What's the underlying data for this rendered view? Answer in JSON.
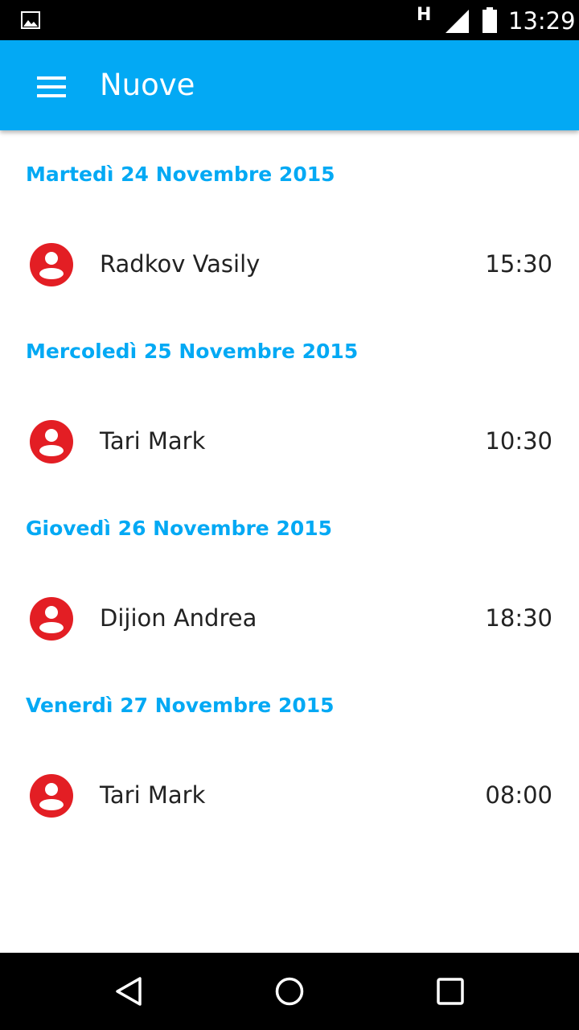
{
  "status_bar": {
    "network_type": "H",
    "time": "13:29",
    "icons": [
      "gallery-icon",
      "signal-icon",
      "battery-icon"
    ]
  },
  "app_bar": {
    "title": "Nuove",
    "menu_icon": "menu-icon"
  },
  "days": [
    {
      "date": "Martedì 24 Novembre 2015",
      "entries": [
        {
          "name": "Radkov Vasily",
          "time": "15:30"
        }
      ]
    },
    {
      "date": "Mercoledì 25 Novembre 2015",
      "entries": [
        {
          "name": "Tari Mark",
          "time": "10:30"
        }
      ]
    },
    {
      "date": "Giovedì 26 Novembre 2015",
      "entries": [
        {
          "name": "Dijion Andrea",
          "time": "18:30"
        }
      ]
    },
    {
      "date": "Venerdì 27 Novembre 2015",
      "entries": [
        {
          "name": "Tari Mark",
          "time": "08:00"
        }
      ]
    }
  ],
  "colors": {
    "primary": "#03A9F4",
    "accent": "#E31E24",
    "text": "#222222",
    "system_bars": "#000000"
  },
  "nav_bar": {
    "icons": [
      "back-icon",
      "home-icon",
      "recents-icon"
    ]
  }
}
